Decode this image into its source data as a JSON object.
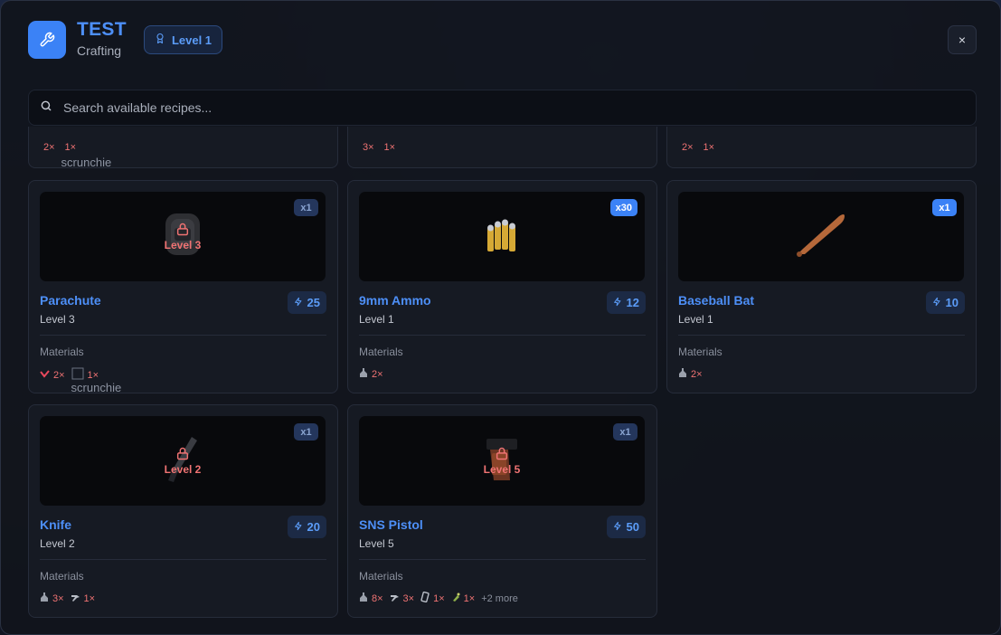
{
  "header": {
    "title": "TEST",
    "subtitle": "Crafting",
    "level_badge": "Level 1",
    "close_label": "×"
  },
  "search": {
    "placeholder": "Search available recipes..."
  },
  "materials_label": "Materials",
  "partial_row": [
    {
      "mats": [
        {
          "icon": "bottle-icon",
          "qty": "2×"
        },
        {
          "icon": "scrunchie-icon",
          "qty": "1×",
          "alt": "scrunchie"
        }
      ]
    },
    {
      "mats": [
        {
          "icon": "bottle-icon",
          "qty": "3×"
        },
        {
          "icon": "tool-icon",
          "qty": "1×"
        }
      ]
    },
    {
      "mats": [
        {
          "icon": "bottle-icon",
          "qty": "2×"
        },
        {
          "icon": "can-icon",
          "qty": "1×"
        }
      ]
    }
  ],
  "recipes": [
    {
      "name": "Parachute",
      "level": "Level 3",
      "qty": "x1",
      "qty_style": "dim",
      "xp": "25",
      "locked": true,
      "lock_text": "Level 3",
      "mats": [
        {
          "icon": "red-item-icon",
          "qty": "2×"
        },
        {
          "icon": "scrunchie-icon",
          "qty": "1×",
          "alt": "scrunchie"
        }
      ],
      "more": ""
    },
    {
      "name": "9mm Ammo",
      "level": "Level 1",
      "qty": "x30",
      "qty_style": "bright",
      "xp": "12",
      "locked": false,
      "lock_text": "",
      "mats": [
        {
          "icon": "bottle-icon",
          "qty": "2×"
        }
      ],
      "more": ""
    },
    {
      "name": "Baseball Bat",
      "level": "Level 1",
      "qty": "x1",
      "qty_style": "bright",
      "xp": "10",
      "locked": false,
      "lock_text": "",
      "mats": [
        {
          "icon": "bottle-icon",
          "qty": "2×"
        }
      ],
      "more": ""
    },
    {
      "name": "Knife",
      "level": "Level 2",
      "qty": "x1",
      "qty_style": "dim",
      "xp": "20",
      "locked": true,
      "lock_text": "Level 2",
      "mats": [
        {
          "icon": "bottle-icon",
          "qty": "3×"
        },
        {
          "icon": "tool-icon",
          "qty": "1×"
        }
      ],
      "more": ""
    },
    {
      "name": "SNS Pistol",
      "level": "Level 5",
      "qty": "x1",
      "qty_style": "dim",
      "xp": "50",
      "locked": true,
      "lock_text": "Level 5",
      "mats": [
        {
          "icon": "bottle-icon",
          "qty": "8×"
        },
        {
          "icon": "tool-icon",
          "qty": "3×"
        },
        {
          "icon": "can-icon",
          "qty": "1×"
        },
        {
          "icon": "green-item-icon",
          "qty": "1×"
        }
      ],
      "more": "+2 more"
    }
  ]
}
